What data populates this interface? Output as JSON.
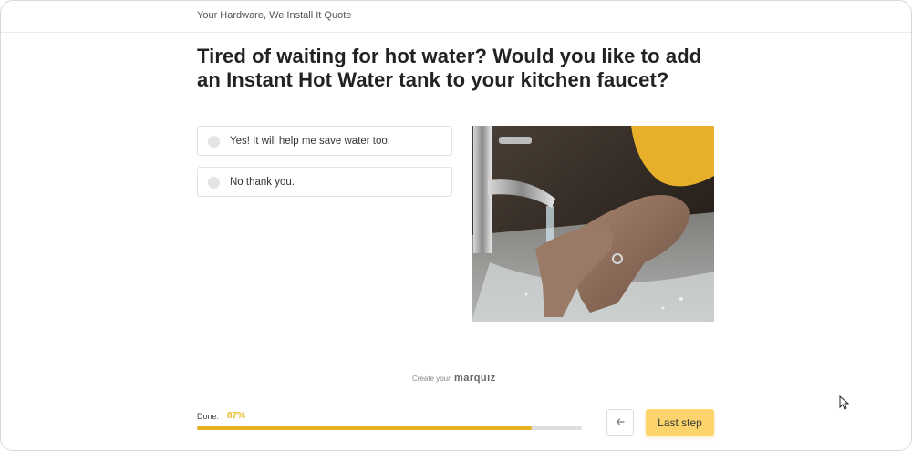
{
  "header": {
    "title": "Your Hardware, We Install It Quote"
  },
  "question": {
    "text": "Tired of waiting for hot water? Would you like to add an Instant Hot Water tank to your kitchen faucet?"
  },
  "options": [
    {
      "label": "Yes! It will help me save water too."
    },
    {
      "label": "No thank you."
    }
  ],
  "branding": {
    "prefix": "Create your",
    "logo": "marquiz"
  },
  "progress": {
    "label": "Done:",
    "value_text": "87%",
    "value": 0.87
  },
  "navigation": {
    "next_label": "Last step",
    "back_icon": "arrow-left-icon"
  },
  "colors": {
    "accent": "#fdd36c",
    "progress": "#e3b21e",
    "progress_text": "#e8b923"
  }
}
